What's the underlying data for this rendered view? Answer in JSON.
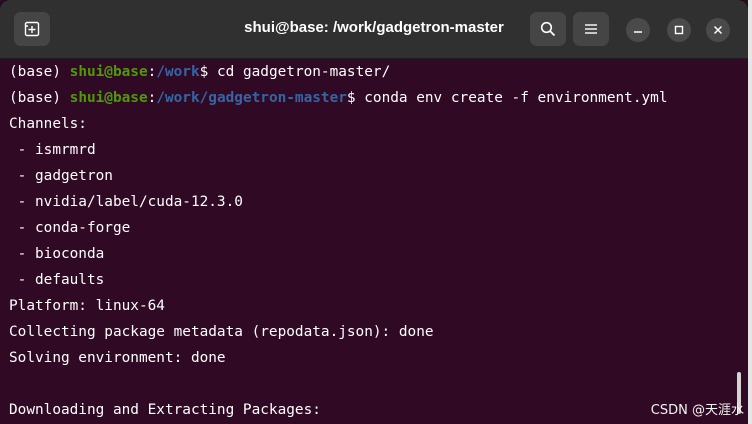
{
  "window": {
    "title": "shui@base: /work/gadgetron-master"
  },
  "colors": {
    "background": "#300a24",
    "titlebar": "#303030",
    "prompt_user": "#4e9a06",
    "prompt_path": "#3465a4",
    "text": "#ffffff"
  },
  "icons": {
    "new_tab": "new-tab-icon",
    "search": "search-icon",
    "menu": "hamburger-menu-icon",
    "minimize": "minimize-icon",
    "maximize": "maximize-icon",
    "close": "close-icon"
  },
  "terminal": {
    "line1": {
      "env": "(base) ",
      "user": "shui@base",
      "sep": ":",
      "path": "/work",
      "cmd": "$ cd gadgetron-master/"
    },
    "line2": {
      "env": "(base) ",
      "user": "shui@base",
      "sep": ":",
      "path": "/work/gadgetron-master",
      "cmd": "$ conda env create -f environment.yml"
    },
    "output": [
      "Channels:",
      " - ismrmrd",
      " - gadgetron",
      " - nvidia/label/cuda-12.3.0",
      " - conda-forge",
      " - bioconda",
      " - defaults",
      "Platform: linux-64",
      "Collecting package metadata (repodata.json): done",
      "Solving environment: done",
      "",
      "Downloading and Extracting Packages:"
    ]
  },
  "watermark": "CSDN @天涯水"
}
